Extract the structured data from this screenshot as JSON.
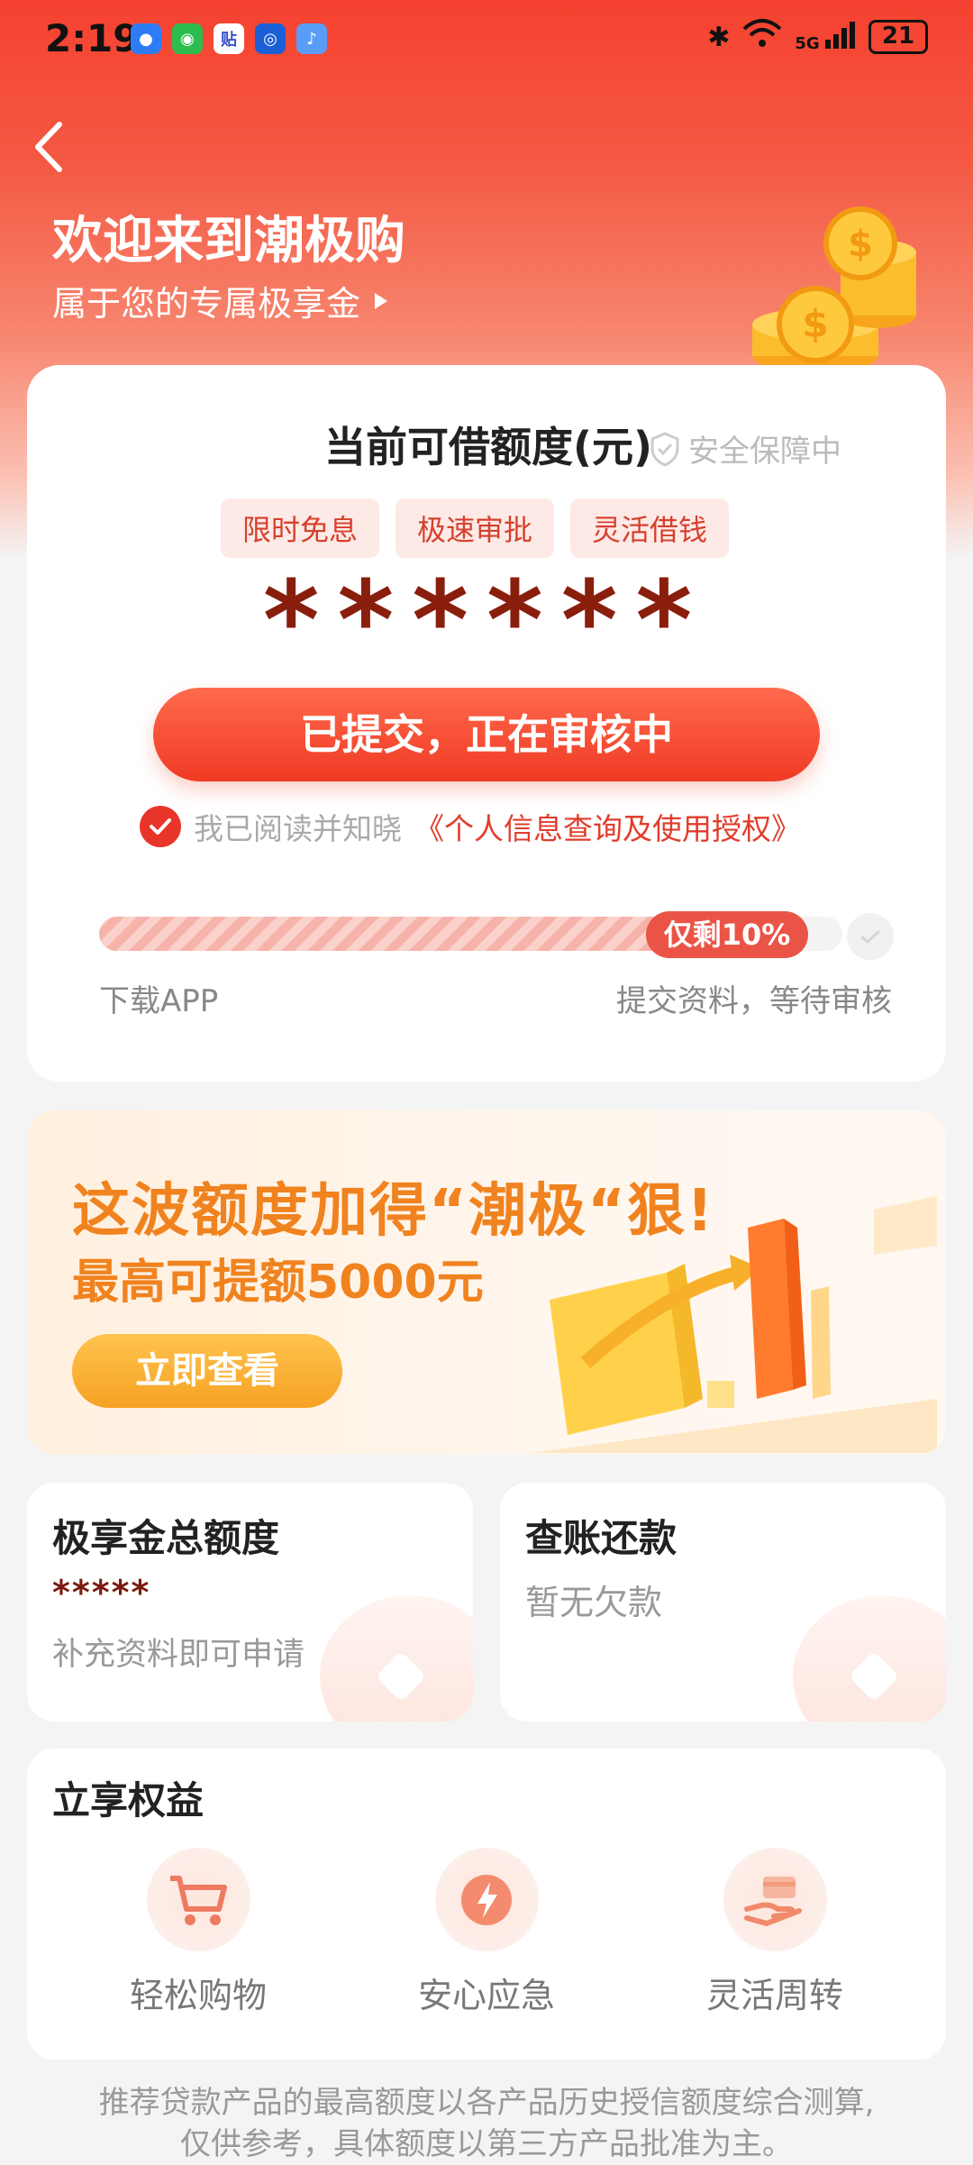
{
  "status_bar": {
    "time": "2:19",
    "battery": "21",
    "network": "5G"
  },
  "header": {
    "title": "欢迎来到潮极购",
    "subtitle": "属于您的专属极享金"
  },
  "credit_card": {
    "limit_title": "当前可借额度(元)",
    "safe_text": "安全保障中",
    "tags": [
      "限时免息",
      "极速审批",
      "灵活借钱"
    ],
    "masked_amount": "******",
    "submit_label": "已提交，正在审核中",
    "agree_text": "我已阅读并知晓",
    "agree_link": "《个人信息查询及使用授权》",
    "progress": {
      "fill_fraction": 0.9,
      "badge": "仅剩10%"
    },
    "step_left": "下载APP",
    "step_right": "提交资料，等待审核"
  },
  "promo": {
    "line1": "这波额度加得“潮极“狠!",
    "line2": "最高可提额5000元",
    "button": "立即查看"
  },
  "total_card": {
    "title": "极享金总额度",
    "masked": "*****",
    "hint": "补充资料即可申请"
  },
  "repay_card": {
    "title": "查账还款",
    "status": "暂无欠款"
  },
  "benefits": {
    "title": "立享权益",
    "items": [
      {
        "label": "轻松购物",
        "icon": "cart-icon"
      },
      {
        "label": "安心应急",
        "icon": "lightning-icon"
      },
      {
        "label": "灵活周转",
        "icon": "hand-card-icon"
      }
    ]
  },
  "footer": {
    "line1": "推荐贷款产品的最高额度以各产品历史授信额度综合测算,",
    "line2": "仅供参考，具体额度以第三方产品批准为主。"
  },
  "colors": {
    "brand": "#f03a24",
    "promo": "#f0831f",
    "masked": "#8a1e0c"
  }
}
